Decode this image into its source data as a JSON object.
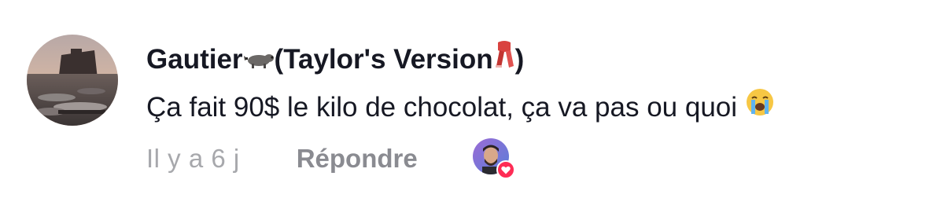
{
  "comment": {
    "username_before": "Gautier",
    "username_after": " (Taylor's Version",
    "username_close": ")",
    "text": "Ça fait 90$ le kilo de chocolat, ça va pas ou quoi",
    "icons": {
      "name_icon_1": "raccoon-icon",
      "name_icon_2": "scarf-icon",
      "text_emoji": "loudly-crying-face-icon",
      "liker_badge": "heart-icon"
    },
    "time": "Il y a 6 j",
    "reply_label": "Répondre",
    "colors": {
      "text": "#161823",
      "meta": "#a7a8ac",
      "reply": "#8a8b91",
      "heart": "#fe2c55"
    }
  }
}
